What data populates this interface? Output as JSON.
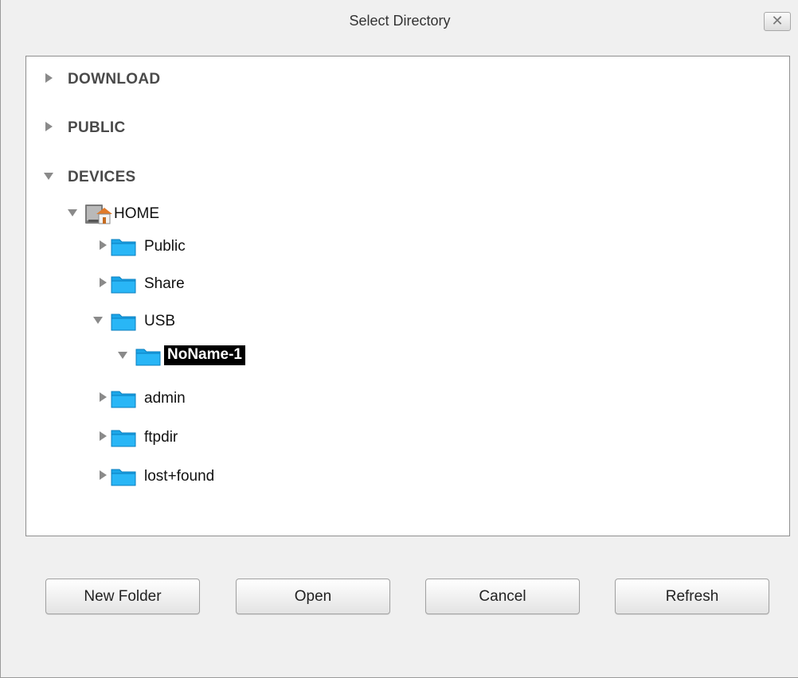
{
  "dialog": {
    "title": "Select Directory",
    "close_label": "✕"
  },
  "tree": {
    "sections": [
      {
        "label": "DOWNLOAD",
        "expanded": false
      },
      {
        "label": "PUBLIC",
        "expanded": false
      },
      {
        "label": "DEVICES",
        "expanded": true
      }
    ],
    "device": {
      "label": "HOME",
      "expanded": true,
      "icon": "home-drive-icon"
    },
    "folders": [
      {
        "label": "Public",
        "expanded": false,
        "selected": false
      },
      {
        "label": "Share",
        "expanded": false,
        "selected": false
      },
      {
        "label": "USB",
        "expanded": true,
        "selected": false
      },
      {
        "label": "NoName-1",
        "expanded": true,
        "selected": true
      },
      {
        "label": "admin",
        "expanded": false,
        "selected": false
      },
      {
        "label": "ftpdir",
        "expanded": false,
        "selected": false
      },
      {
        "label": "lost+found",
        "expanded": false,
        "selected": false
      }
    ]
  },
  "buttons": {
    "new_folder": "New Folder",
    "open": "Open",
    "cancel": "Cancel",
    "refresh": "Refresh"
  },
  "colors": {
    "folder": "#1ba6e8",
    "selection_bg": "#000000",
    "selection_fg": "#ffffff"
  }
}
